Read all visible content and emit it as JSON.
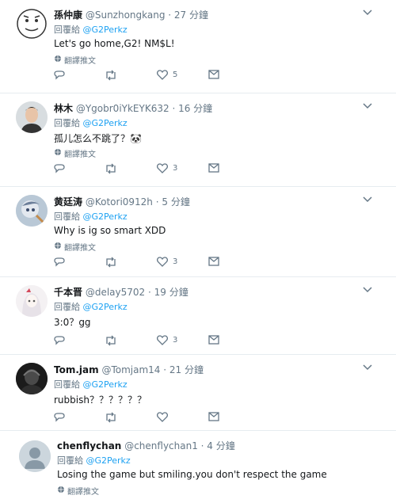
{
  "reply_prefix": "回覆給",
  "translate_label": "翻譯推文",
  "tweets": [
    {
      "name": "孫仲康",
      "handle": "@Sunzhongkang",
      "time": "· 27 分鐘",
      "reply_to": "@G2Perkz",
      "text": "Let's go home,G2! NM$L!",
      "likes": "5",
      "avatar": "cartoon-face"
    },
    {
      "name": "林木",
      "handle": "@Ygobr0iYkEYK632",
      "time": "· 16 分鐘",
      "reply_to": "@G2Perkz",
      "text": "孤儿怎么不跳了？🐼",
      "likes": "3",
      "avatar": "person-photo"
    },
    {
      "name": "黄廷涛",
      "handle": "@Kotori0912h",
      "time": "· 5 分鐘",
      "reply_to": "@G2Perkz",
      "text": "Why is ig so smart XDD",
      "likes": "3",
      "avatar": "anime-art"
    },
    {
      "name": "千本晋",
      "handle": "@delay5702",
      "time": "· 19 分鐘",
      "reply_to": "@G2Perkz",
      "text": "3:0？gg",
      "likes": "3",
      "avatar": "anime-girl"
    },
    {
      "name": "Tom.jam",
      "handle": "@Tomjam14",
      "time": "· 21 分鐘",
      "reply_to": "@G2Perkz",
      "text": "rubbish？？？？？？",
      "likes": "",
      "avatar": "dark-photo"
    },
    {
      "name": "chenflychan",
      "handle": "@chenflychan1",
      "time": "· 4 分鐘",
      "reply_to": "@G2Perkz",
      "text": "Losing the game but smiling.you don't respect the game",
      "likes": "",
      "avatar": "default"
    }
  ]
}
